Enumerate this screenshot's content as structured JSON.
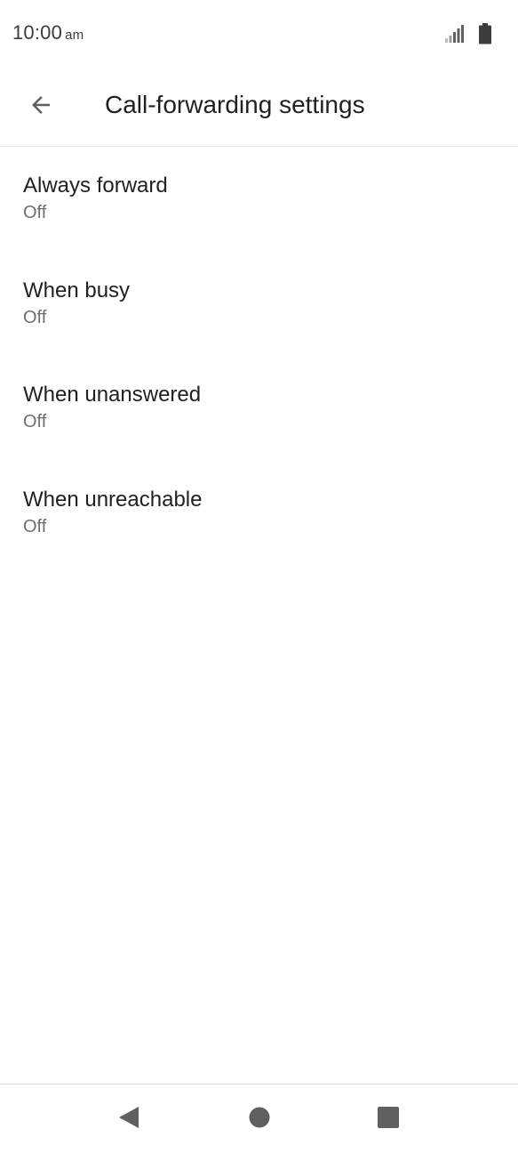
{
  "status_bar": {
    "time": "10:00",
    "ampm": "am",
    "icons": [
      "signal-icon",
      "battery-icon"
    ]
  },
  "app_bar": {
    "back_icon": "arrow-back-icon",
    "title": "Call-forwarding settings"
  },
  "settings": [
    {
      "title": "Always forward",
      "summary": "Off"
    },
    {
      "title": "When busy",
      "summary": "Off"
    },
    {
      "title": "When unanswered",
      "summary": "Off"
    },
    {
      "title": "When unreachable",
      "summary": "Off"
    }
  ],
  "nav_bar": {
    "icons": [
      "nav-back-icon",
      "nav-home-icon",
      "nav-recents-icon"
    ]
  },
  "colors": {
    "text_primary": "#202124",
    "text_secondary": "#6f6f6f",
    "icon": "#5f5f5f",
    "divider": "#e3e3e3"
  }
}
